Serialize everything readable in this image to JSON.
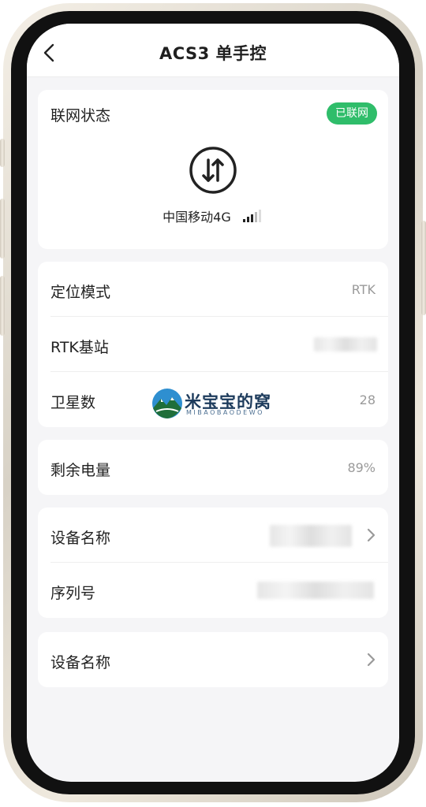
{
  "header": {
    "title": "ACS3 单手控"
  },
  "network": {
    "label": "联网状态",
    "status": "已联网",
    "carrier": "中国移动4G",
    "status_color": "#2fbd6a"
  },
  "positioning": {
    "mode_label": "定位模式",
    "mode_value": "RTK",
    "base_label": "RTK基站",
    "sat_label": "卫星数",
    "sat_value": "28"
  },
  "battery": {
    "label": "剩余电量",
    "value": "89%"
  },
  "device": {
    "name_label": "设备名称",
    "serial_label": "序列号"
  },
  "extra": {
    "name_label": "设备名称"
  },
  "watermark": {
    "title": "米宝宝的窝",
    "subtitle": "MIBAOBAODEWO"
  }
}
